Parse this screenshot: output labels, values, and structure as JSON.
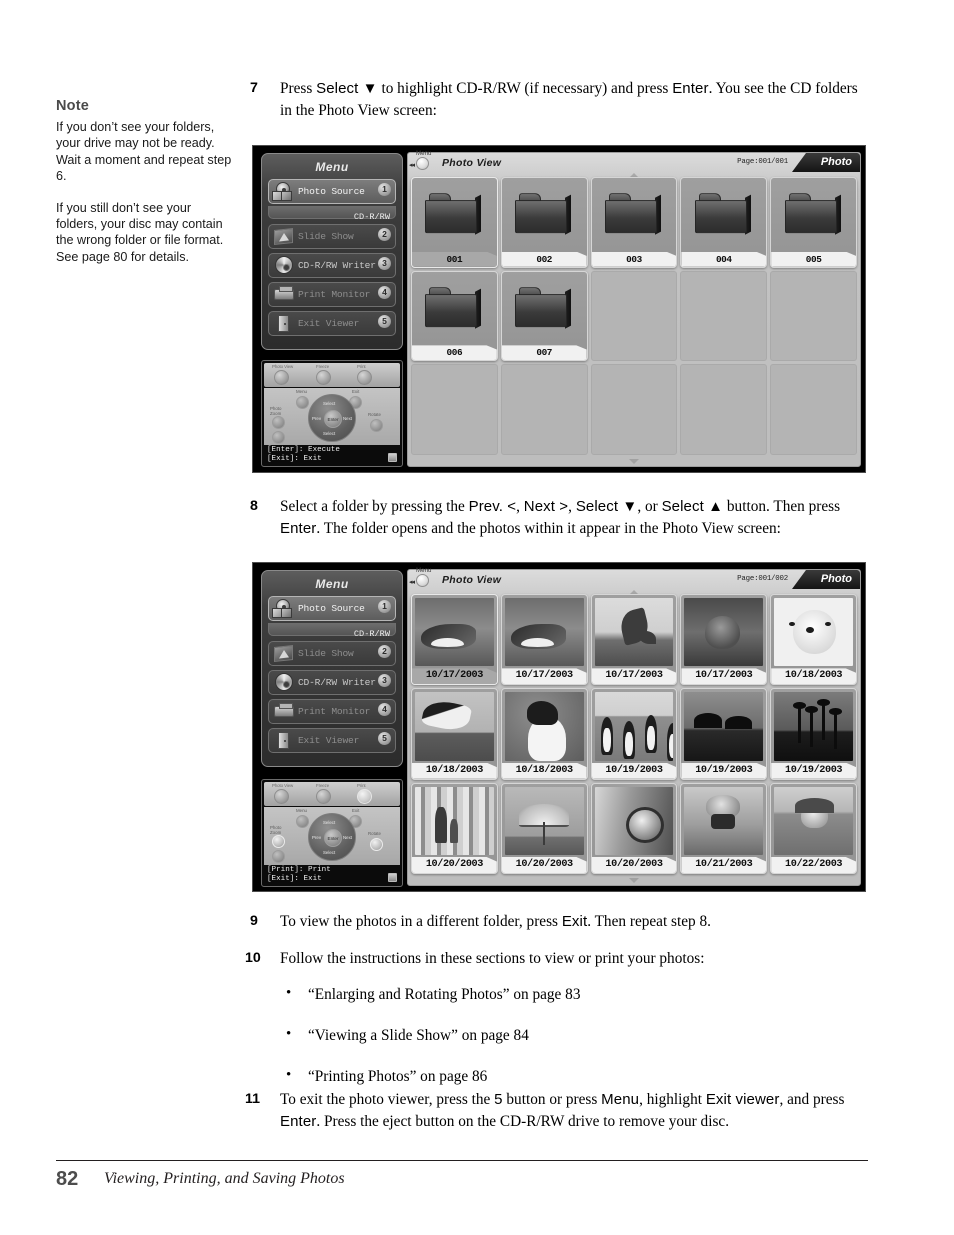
{
  "note": {
    "title": "Note",
    "paragraphs": [
      "If you don’t see your folders, your drive may not be ready. Wait a moment and repeat step 6.",
      "If you still don’t see your folders, your disc may contain the wrong folder or file format. See page 80 for details."
    ]
  },
  "steps": {
    "s7": {
      "num": "7",
      "t1": "Press ",
      "ui1": "Select ▼",
      "t2": " to highlight CD-R/RW (if necessary) and press ",
      "ui2": "Enter",
      "t3": ". You see the CD folders in the Photo View screen:"
    },
    "s8": {
      "num": "8",
      "t1": "Select a folder by pressing the ",
      "ui1": "Prev. <",
      "t2": ", ",
      "ui2": "Next >",
      "t3": ", ",
      "ui3": "Select ▼",
      "t4": ", or ",
      "ui4": "Select ▲",
      "t5": " button. Then press ",
      "ui5": "Enter",
      "t6": ". The folder opens and the photos within it appear in the Photo View screen:"
    },
    "s9": {
      "num": "9",
      "t1": "To view the photos in a different folder, press ",
      "ui1": "Exit",
      "t2": ". Then repeat step 8."
    },
    "s10": {
      "num": "10",
      "t1": "Follow the instructions in these sections to view or print your photos:",
      "bullets": [
        "“Enlarging and Rotating Photos” on page 83",
        "“Viewing a Slide Show” on page 84",
        "“Printing Photos” on page 86"
      ]
    },
    "s11": {
      "num": "11",
      "t1": "To exit the photo viewer, press the ",
      "ui1": "5",
      "t2": " button or press ",
      "ui2": "Menu",
      "t3": ", highlight ",
      "ui3": "Exit viewer",
      "t4": ", and press ",
      "ui4": "Enter",
      "t5": ". Press the eject button on the CD-R/RW drive to remove your disc."
    }
  },
  "footer": {
    "page": "82",
    "title": "Viewing, Printing, and Saving Photos"
  },
  "device_menu": {
    "title": "Menu",
    "items": [
      {
        "label": "Photo Source",
        "badge": "1",
        "icon": "photo-source-icon",
        "state": "active"
      },
      {
        "label": "Slide Show",
        "badge": "2",
        "icon": "slide-show-icon",
        "state": "dim"
      },
      {
        "label": "CD-R/RW Writer",
        "badge": "3",
        "icon": "cd-writer-icon",
        "state": "normal"
      },
      {
        "label": "Print Monitor",
        "badge": "4",
        "icon": "printer-icon",
        "state": "dim"
      },
      {
        "label": "Exit Viewer",
        "badge": "5",
        "icon": "exit-door-icon",
        "state": "dim"
      }
    ],
    "source_value": "CD-R/RW"
  },
  "remote": {
    "top_labels": [
      "Photo View",
      "Freeze",
      "Print"
    ],
    "menu_label": "Menu",
    "exit_label": "Exit",
    "select_up": "Select",
    "select_down": "Select",
    "prev_label": "Prev",
    "next_label": "Next",
    "enter_label": "Enter",
    "photo_zoom_label": "Photo Zoom",
    "rotate_label": "Rotate"
  },
  "screenshot1": {
    "menu_knob_label": "Menu",
    "view_title": "Photo View",
    "page": "Page:001/001",
    "tab": "Photo",
    "status_line1": "[Enter]: Execute",
    "status_line2": "[Exit]: Exit",
    "cells": [
      {
        "kind": "folder",
        "label": "001",
        "selected": true
      },
      {
        "kind": "folder",
        "label": "002",
        "selected": false
      },
      {
        "kind": "folder",
        "label": "003",
        "selected": false
      },
      {
        "kind": "folder",
        "label": "004",
        "selected": false
      },
      {
        "kind": "folder",
        "label": "005",
        "selected": false
      },
      {
        "kind": "folder",
        "label": "006",
        "selected": false
      },
      {
        "kind": "folder",
        "label": "007",
        "selected": false
      },
      {
        "kind": "empty",
        "label": ""
      },
      {
        "kind": "empty",
        "label": ""
      },
      {
        "kind": "empty",
        "label": ""
      },
      {
        "kind": "empty",
        "label": ""
      },
      {
        "kind": "empty",
        "label": ""
      },
      {
        "kind": "empty",
        "label": ""
      },
      {
        "kind": "empty",
        "label": ""
      },
      {
        "kind": "empty",
        "label": ""
      }
    ]
  },
  "screenshot2": {
    "menu_knob_label": "Menu",
    "view_title": "Photo View",
    "page": "Page:001/002",
    "tab": "Photo",
    "status_line1": "[Print]: Print",
    "status_line2": "[Exit]: Exit",
    "cells": [
      {
        "kind": "photo",
        "label": "10/17/2003",
        "art": "dolphin1",
        "selected": true
      },
      {
        "kind": "photo",
        "label": "10/17/2003",
        "art": "dolphin1",
        "selected": false
      },
      {
        "kind": "photo",
        "label": "10/17/2003",
        "art": "jump",
        "selected": false
      },
      {
        "kind": "photo",
        "label": "10/17/2003",
        "art": "otter",
        "selected": false
      },
      {
        "kind": "photo",
        "label": "10/18/2003",
        "art": "seal",
        "selected": false
      },
      {
        "kind": "photo",
        "label": "10/18/2003",
        "art": "pengswim",
        "selected": false
      },
      {
        "kind": "photo",
        "label": "10/18/2003",
        "art": "pengface",
        "selected": false
      },
      {
        "kind": "photo",
        "label": "10/19/2003",
        "art": "pengs",
        "selected": false
      },
      {
        "kind": "photo",
        "label": "10/19/2003",
        "art": "parasol",
        "selected": false
      },
      {
        "kind": "photo",
        "label": "10/19/2003",
        "art": "palms",
        "selected": false
      },
      {
        "kind": "photo",
        "label": "10/20/2003",
        "art": "bamboo",
        "selected": false
      },
      {
        "kind": "photo",
        "label": "10/20/2003",
        "art": "carousel",
        "selected": false
      },
      {
        "kind": "photo",
        "label": "10/20/2003",
        "art": "camera1",
        "selected": false
      },
      {
        "kind": "photo",
        "label": "10/21/2003",
        "art": "camera2",
        "selected": false
      },
      {
        "kind": "photo",
        "label": "10/22/2003",
        "art": "swim",
        "selected": false
      }
    ]
  }
}
